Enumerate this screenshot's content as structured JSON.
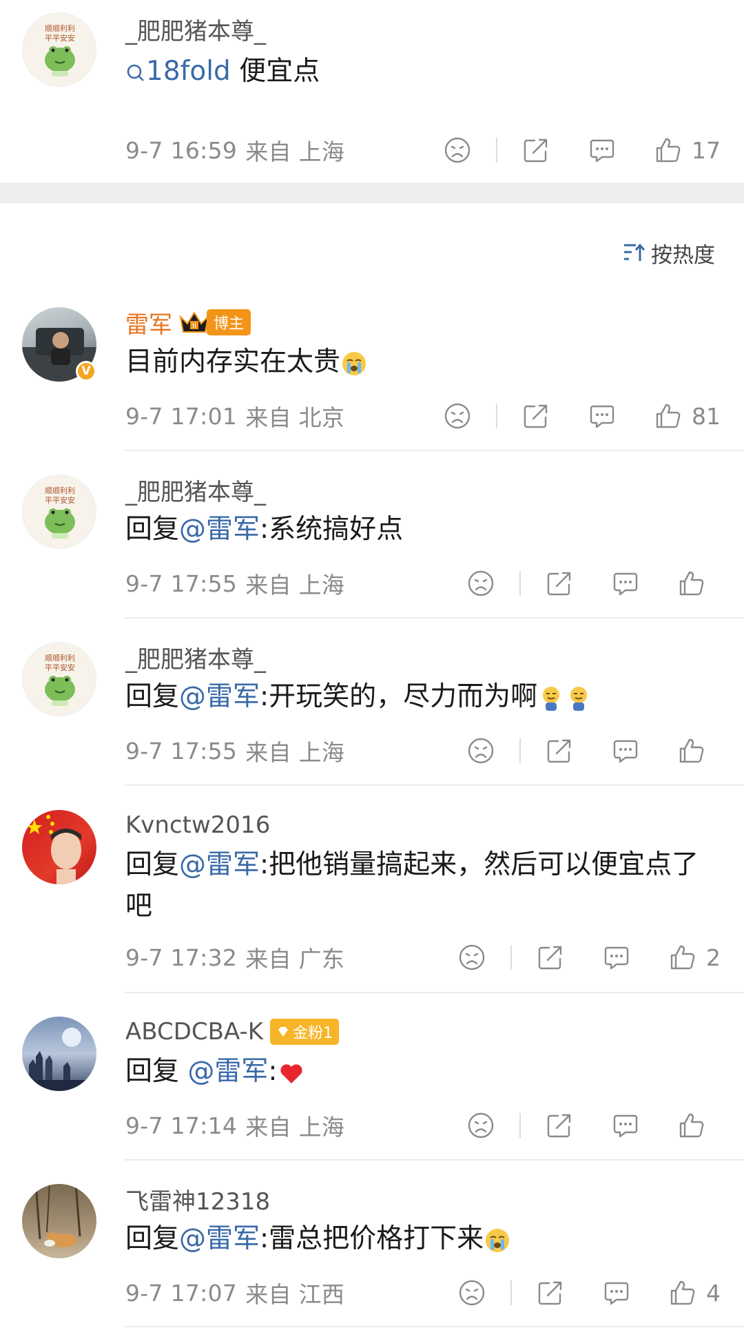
{
  "post": {
    "author": "_肥肥猪本尊_",
    "avatar_text_line1": "顺顺利利",
    "avatar_text_line2": "平平安安",
    "search_term": "18fold",
    "text_after": " 便宜点",
    "date": "9-7 16:59",
    "location": "来自 上海",
    "likes": "17"
  },
  "sort": {
    "label": "按热度"
  },
  "comments": [
    {
      "author": "雷军",
      "badge": "博主",
      "text": "目前内存实在太贵",
      "date": "9-7 17:01",
      "location": "来自 北京",
      "likes": "81"
    },
    {
      "author": "_肥肥猪本尊_",
      "reply_prefix": "回复",
      "mention": "@雷军",
      "text": ":系统搞好点",
      "date": "9-7 17:55",
      "location": "来自 上海",
      "likes": ""
    },
    {
      "author": "_肥肥猪本尊_",
      "reply_prefix": "回复",
      "mention": "@雷军",
      "text": ":开玩笑的，尽力而为啊",
      "date": "9-7 17:55",
      "location": "来自 上海",
      "likes": ""
    },
    {
      "author": "Kvnctw2016",
      "reply_prefix": "回复",
      "mention": "@雷军",
      "text": ":把他销量搞起来，然后可以便宜点了吧",
      "date": "9-7 17:32",
      "location": "来自 广东",
      "likes": "2"
    },
    {
      "author": "ABCDCBA-K",
      "badge": "金粉1",
      "reply_prefix": "回复 ",
      "mention": "@雷军",
      "text": ":",
      "date": "9-7 17:14",
      "location": "来自 上海",
      "likes": ""
    },
    {
      "author": "飞雷神12318",
      "reply_prefix": "回复",
      "mention": "@雷军",
      "text": ":雷总把价格打下来",
      "date": "9-7 17:07",
      "location": "来自 江西",
      "likes": "4"
    }
  ],
  "colors": {
    "accent_link": "#3a6aa8",
    "author_highlight": "#e8731a",
    "meta_text": "#8a8a8a",
    "separator": "#eeeeee"
  }
}
